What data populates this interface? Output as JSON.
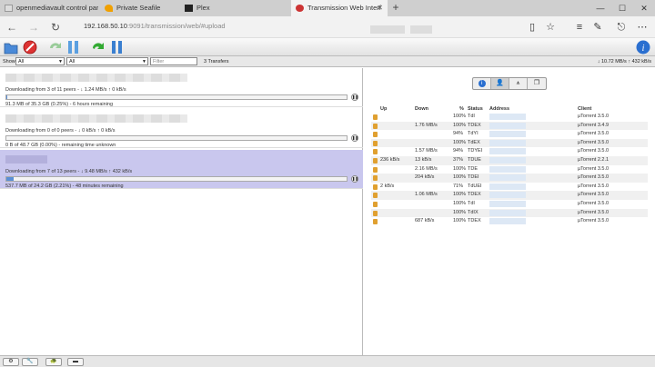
{
  "browser": {
    "tabs": [
      {
        "label": "openmediavault control par",
        "active": false
      },
      {
        "label": "Private Seafile",
        "active": false
      },
      {
        "label": "Plex",
        "active": false
      },
      {
        "label": "Transmission Web Interf",
        "active": true
      }
    ],
    "address": {
      "host": "192.168.50.10",
      "path": ":9091/transmission/web/#upload"
    }
  },
  "filterbar": {
    "show_label": "Show",
    "state_filter": "All",
    "tracker_filter": "All",
    "filter_placeholder": "Filter",
    "count": "3 Transfers",
    "speeds": "↓ 10.72 MB/s ↑ 432 kB/s"
  },
  "torrents": [
    {
      "peers": "Downloading from 3 of 11 peers - ↓ 1.24 MB/s ↑ 0 kB/s",
      "progress_text": "91.3 MB of 35.3 GB (0.25%) - 6 hours remaining",
      "progress": 0.0025,
      "selected": false
    },
    {
      "peers": "Downloading from 0 of 0 peers - ↓ 0 kB/s ↑ 0 kB/s",
      "progress_text": "0 B of 48.7 GB (0.00%) - remaining time unknown",
      "progress": 0.0,
      "selected": false
    },
    {
      "peers": "Downloading from 7 of 13 peers - ↓ 9.48 MB/s ↑ 432 kB/s",
      "progress_text": "537.7 MB of 24.2 GB (2.21%) - 48 minutes remaining",
      "progress": 0.0221,
      "selected": true
    }
  ],
  "inspector": {
    "headers": {
      "up": "Up",
      "down": "Down",
      "pct": "%",
      "status": "Status",
      "address": "Address",
      "client": "Client"
    },
    "peers": [
      {
        "up": "",
        "down": "",
        "pct": "100%",
        "status": "TdI",
        "client": "µTorrent 3.5.0"
      },
      {
        "up": "",
        "down": "1.76 MB/s",
        "pct": "100%",
        "status": "TDEX",
        "client": "µTorrent 3.4.9"
      },
      {
        "up": "",
        "down": "",
        "pct": "94%",
        "status": "TdYI",
        "client": "µTorrent 3.5.0"
      },
      {
        "up": "",
        "down": "",
        "pct": "100%",
        "status": "TdEX",
        "client": "µTorrent 3.5.0"
      },
      {
        "up": "",
        "down": "1.57 MB/s",
        "pct": "94%",
        "status": "TDYEI",
        "client": "µTorrent 3.5.0"
      },
      {
        "up": "236 kB/s",
        "down": "13 kB/s",
        "pct": "37%",
        "status": "TDUE",
        "client": "µTorrent 2.2.1"
      },
      {
        "up": "",
        "down": "2.16 MB/s",
        "pct": "100%",
        "status": "TDE",
        "client": "µTorrent 3.5.0"
      },
      {
        "up": "",
        "down": "204 kB/s",
        "pct": "100%",
        "status": "TDEI",
        "client": "µTorrent 3.5.0"
      },
      {
        "up": "2 kB/s",
        "down": "",
        "pct": "71%",
        "status": "TdUEI",
        "client": "µTorrent 3.5.0"
      },
      {
        "up": "",
        "down": "1.06 MB/s",
        "pct": "100%",
        "status": "TDEX",
        "client": "µTorrent 3.5.0"
      },
      {
        "up": "",
        "down": "",
        "pct": "100%",
        "status": "TdI",
        "client": "µTorrent 3.5.0"
      },
      {
        "up": "",
        "down": "",
        "pct": "100%",
        "status": "TdIX",
        "client": "µTorrent 3.5.0"
      },
      {
        "up": "",
        "down": "687 kB/s",
        "pct": "100%",
        "status": "TDEX",
        "client": "µTorrent 3.5.0"
      }
    ]
  }
}
